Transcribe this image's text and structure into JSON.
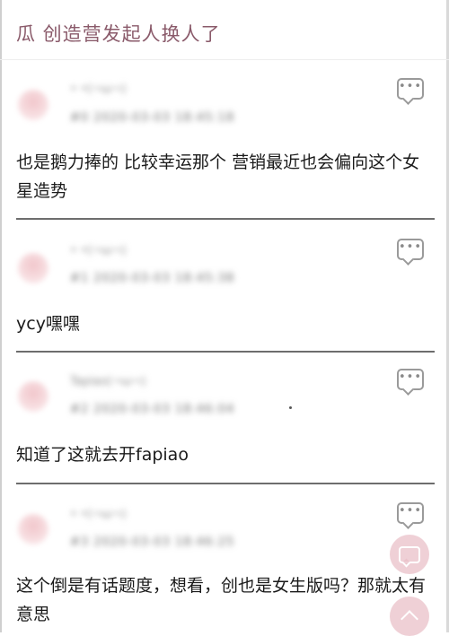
{
  "thread": {
    "title": "瓜 创造营发起人换人了"
  },
  "posts": [
    {
      "author": "• •(¬ω¬)",
      "meta": "#0 2020-03-03 18:45:18",
      "body": "也是鹅力捧的 比较幸运那个 营销最近也会偏向这个女星造势"
    },
    {
      "author": "• •(¬ω¬)",
      "meta": "#1 2020-03-03 18:45:38",
      "body": "ycy嘿嘿"
    },
    {
      "author": "Tapiao(¬ω¬)",
      "meta": "#2 2020-03-03 18:46:04",
      "body": "知道了这就去开fapiao"
    },
    {
      "author": "• •(¬ω¬)",
      "meta": "#3 2020-03-03 18:46:25",
      "body": "这个倒是有话题度，想看，创也是女生版吗？那就太有意思"
    }
  ],
  "icons": {
    "reply": "comment-icon",
    "fab_chat": "chat-icon",
    "fab_up": "chevron-up-icon"
  },
  "colors": {
    "title": "#8a5a6a",
    "fab": "#e9bec6",
    "divider": "#6d6d6d"
  }
}
